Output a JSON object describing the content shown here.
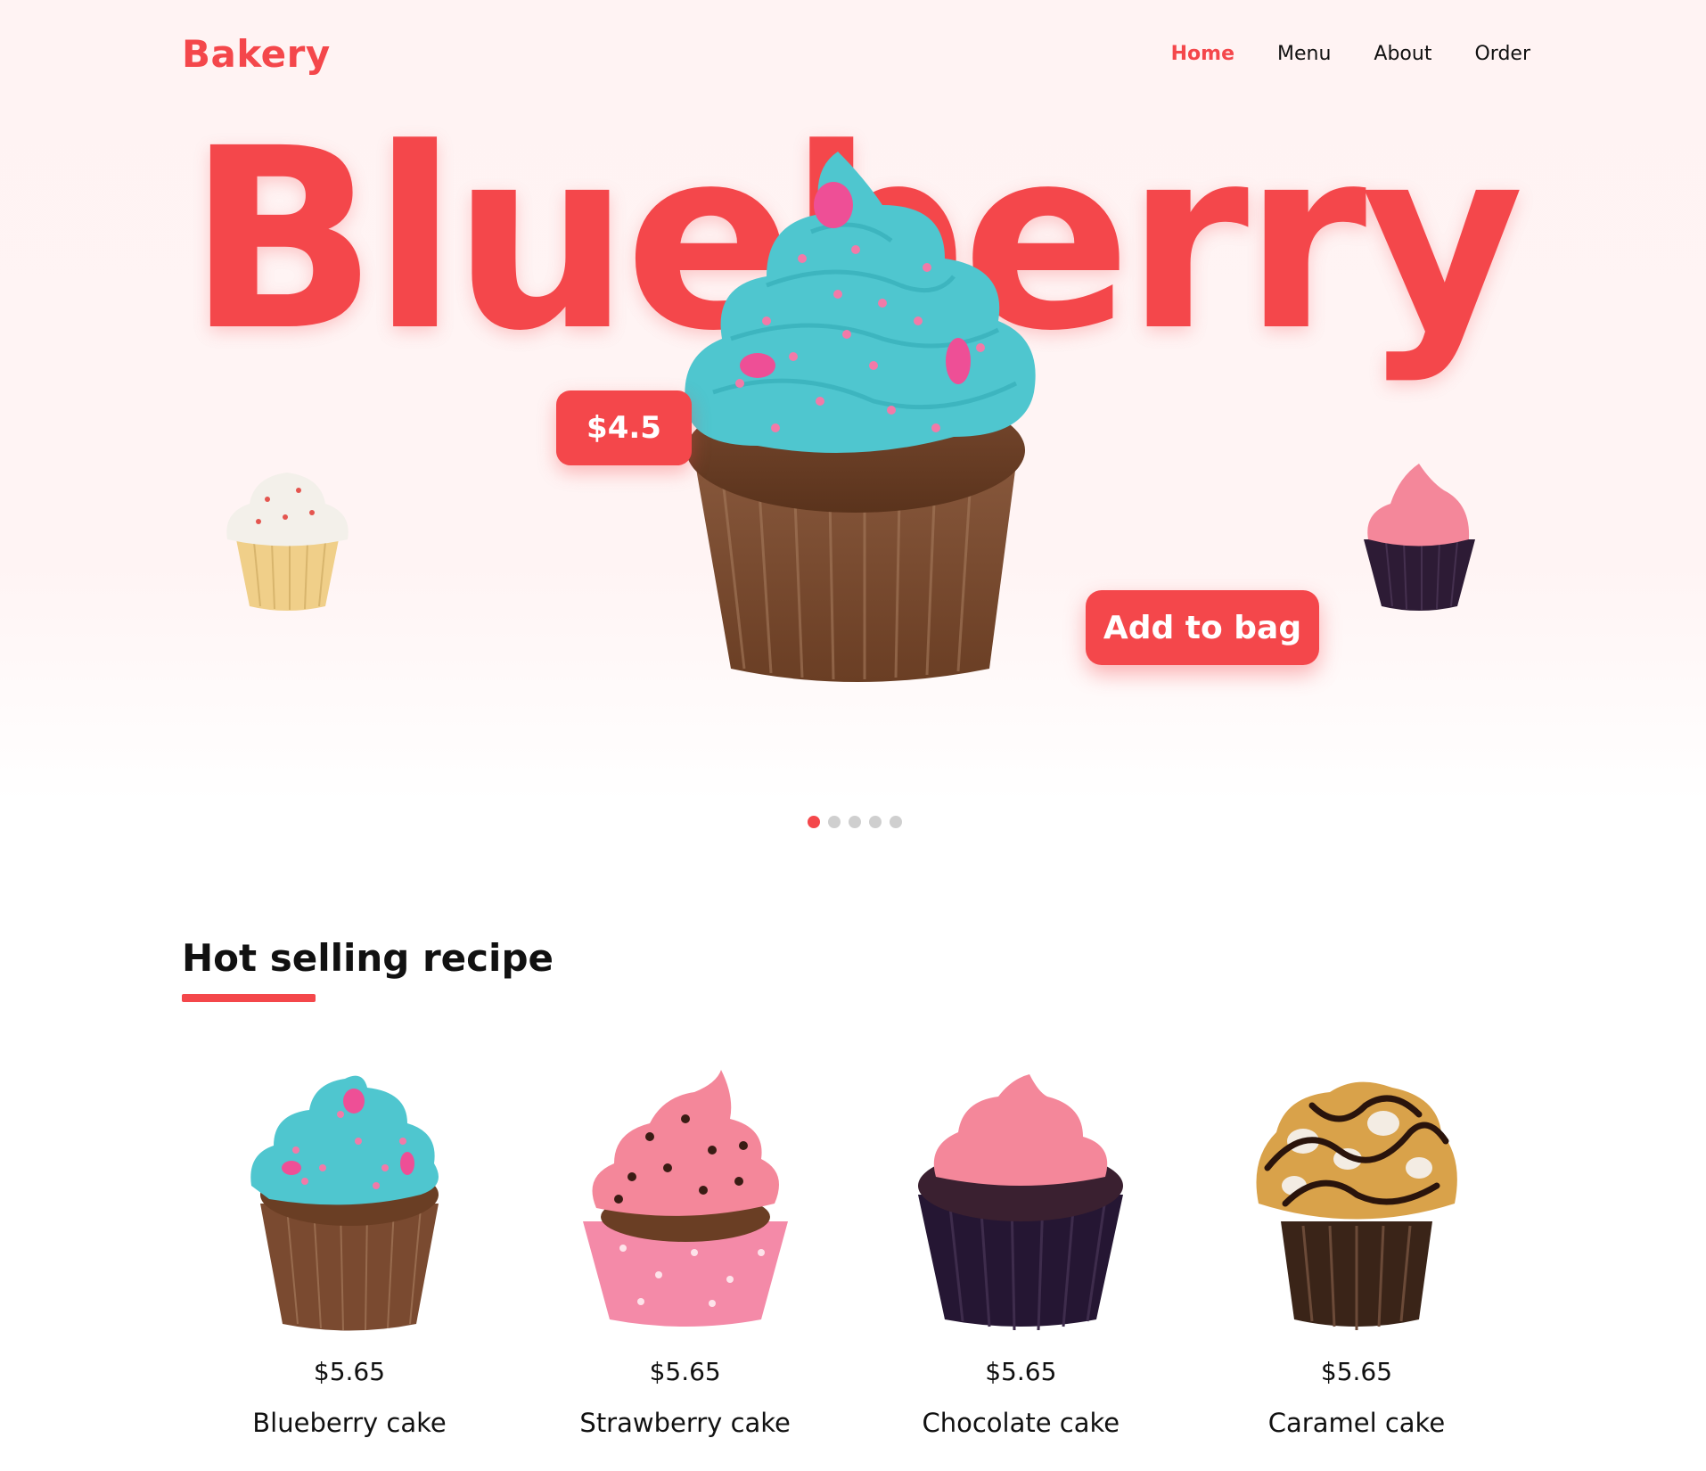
{
  "brand": {
    "logo": "Bakery"
  },
  "nav": {
    "items": [
      {
        "label": "Home",
        "active": true
      },
      {
        "label": "Menu",
        "active": false
      },
      {
        "label": "About",
        "active": false
      },
      {
        "label": "Order",
        "active": false
      }
    ]
  },
  "hero": {
    "word": "Blueberry",
    "price": "$4.5",
    "cta": "Add to bag",
    "slides_total": 5,
    "slide_active": 1
  },
  "section": {
    "title": "Hot selling recipe"
  },
  "products": [
    {
      "price": "$5.65",
      "name": "Blueberry cake",
      "icon": "blueberry-cupcake-icon"
    },
    {
      "price": "$5.65",
      "name": "Strawberry cake",
      "icon": "strawberry-cupcake-icon"
    },
    {
      "price": "$5.65",
      "name": "Chocolate cake",
      "icon": "chocolate-cupcake-icon"
    },
    {
      "price": "$5.65",
      "name": "Caramel cake",
      "icon": "caramel-cupcake-icon"
    }
  ],
  "colors": {
    "accent": "#f4474b",
    "hero_bg": "#fff3f3",
    "frosting_blue": "#4fc6cf",
    "frosting_pink": "#f4879a",
    "frosting_white": "#f3f0ea"
  }
}
